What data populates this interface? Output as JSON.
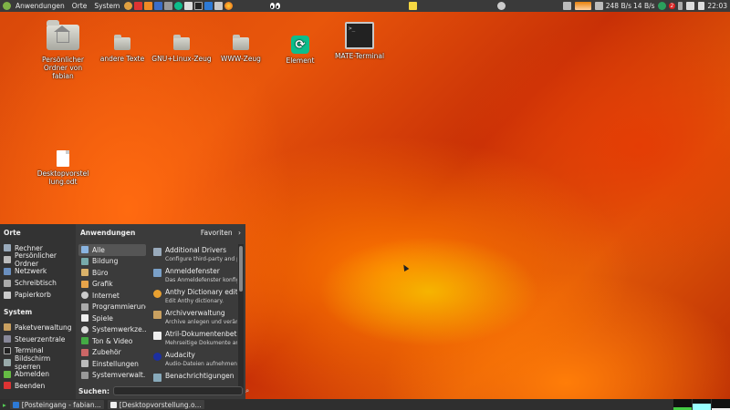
{
  "top_panel": {
    "menus": [
      "Anwendungen",
      "Orte",
      "System"
    ],
    "net_down": "248 B/s",
    "net_up": "14 B/s",
    "badge_count": "2",
    "clock": "22:03"
  },
  "desktop": {
    "home_folder": "Persönlicher Ordner von fabian",
    "folder1": "andere Texte",
    "folder2": "GNU+Linux-Zeug",
    "folder3": "WWW-Zeug",
    "element": "Element",
    "terminal": "MATE-Terminal",
    "document": "Desktopvorstellung.odt",
    "terminal_prompt": ">_"
  },
  "menu": {
    "places_heading": "Orte",
    "places": [
      "Rechner",
      "Persönlicher Ordner",
      "Netzwerk",
      "Schreibtisch",
      "Papierkorb"
    ],
    "system_heading": "System",
    "system": [
      "Paketverwaltung",
      "Steuerzentrale",
      "Terminal",
      "Bildschirm sperren",
      "Abmelden",
      "Beenden"
    ],
    "apps_heading": "Anwendungen",
    "favorites_label": "Favoriten",
    "categories": [
      "Alle",
      "Bildung",
      "Büro",
      "Grafik",
      "Internet",
      "Programmierung",
      "Spiele",
      "Systemwerkze...",
      "Ton & Video",
      "Zubehör",
      "Einstellungen",
      "Systemverwalt..."
    ],
    "apps": [
      {
        "name": "Additional Drivers",
        "desc": "Configure third-party and p..."
      },
      {
        "name": "Anmeldefenster",
        "desc": "Das Anmeldefenster konfig..."
      },
      {
        "name": "Anthy Dictionary editor",
        "desc": "Edit Anthy dictionary."
      },
      {
        "name": "Archivverwaltung",
        "desc": "Archive anlegen und verän..."
      },
      {
        "name": "Atril-Dokumentenbetr...",
        "desc": "Mehrseitige Dokumente an..."
      },
      {
        "name": "Audacity",
        "desc": "Audio-Dateien aufnehmen ..."
      },
      {
        "name": "Benachrichtigungen",
        "desc": ""
      }
    ],
    "search_label": "Suchen:",
    "search_value": ""
  },
  "taskbar": {
    "tasks": [
      "[Posteingang - fabian...",
      "[Desktopvorstellung.o..."
    ]
  },
  "colors": {
    "panel": "#3a3a3a",
    "menu_bg": "#3b3b3b",
    "element_green": "#0dbd8b"
  }
}
